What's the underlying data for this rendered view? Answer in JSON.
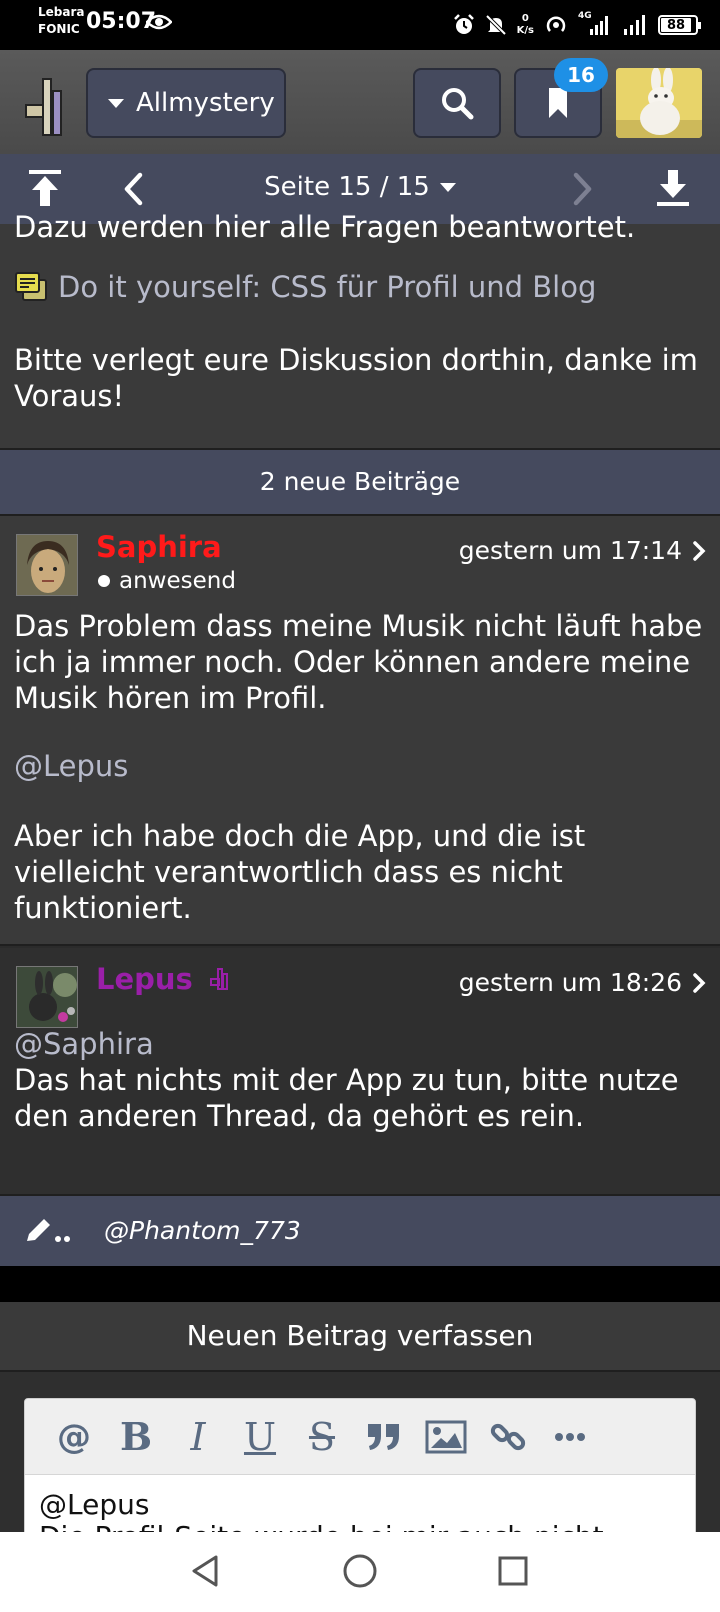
{
  "status_bar": {
    "carrier_line1": "Lebara",
    "carrier_line2": "FONIC",
    "time": "05:07",
    "net_speed_value": "0",
    "net_speed_unit": "K/s",
    "network_type": "4G",
    "battery": "88"
  },
  "header": {
    "site_name": "Allmystery",
    "bookmark_count": "16"
  },
  "pagination": {
    "label": "Seite 15 / 15"
  },
  "intro": {
    "cut_line": "Dazu werden hier alle Fragen beantwortet.",
    "link": "Do it yourself: CSS für Profil und Blog",
    "message": "Bitte verlegt eure Diskussion dorthin, danke im Voraus!"
  },
  "new_posts_label": "2 neue Beiträge",
  "posts": [
    {
      "author": "Saphira",
      "author_color": "#ff1a1a",
      "status": "anwesend",
      "time": "gestern um 17:14",
      "text1": "Das Problem dass meine Musik nicht läuft habe ich ja immer noch. Oder können andere meine Musik hören im Profil.",
      "mention": "@Lepus",
      "text2": "Aber ich habe doch die App, und die ist vielleicht verantwortlich dass es nicht funktioniert."
    },
    {
      "author": "Lepus",
      "author_color": "#9a1fa8",
      "time": "gestern um 18:26",
      "mention": "@Saphira",
      "text1": "Das hat nichts mit der App zu tun, bitte nutze den anderen Thread, da gehört es rein."
    }
  ],
  "reply_bar": {
    "typing_user": "@Phantom_773"
  },
  "compose": {
    "title": "Neuen Beitrag verfassen",
    "toolbar": [
      "at-icon",
      "bold-icon",
      "italic-icon",
      "underline-icon",
      "strikethrough-icon",
      "quote-icon",
      "image-icon",
      "link-icon",
      "more-icon"
    ],
    "bold_label": "B",
    "italic_label": "I",
    "underline_label": "U",
    "strike_label": "S",
    "at_label": "@",
    "editor_line1": "@Lepus",
    "editor_line2": "Die Profil-Seite wurde bei mir auch nicht"
  },
  "icons": {
    "logo": "allmystery-logo",
    "search": "search-icon",
    "bookmark": "bookmark-icon",
    "scroll_top": "scroll-top-icon",
    "prev": "chevron-left-icon",
    "next": "chevron-right-icon",
    "scroll_bottom": "download-icon",
    "typing": "pencil-icon",
    "nav_back": "triangle-back-icon",
    "nav_home": "circle-home-icon",
    "nav_recent": "square-recent-icon"
  },
  "colors": {
    "accent_bar": "#454a5e",
    "badge": "#1e90e6",
    "mention": "#b8bbcb"
  }
}
